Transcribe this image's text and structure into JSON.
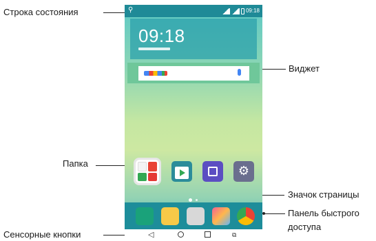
{
  "callouts": {
    "status_bar": "Строка состояния",
    "widget": "Виджет",
    "folder": "Папка",
    "page_indicator": "Значок страницы",
    "quick_access_line1": "Панель быстрого",
    "quick_access_line2": "доступа",
    "touch_buttons": "Сенсорные кнопки"
  },
  "phone": {
    "status_bar": {
      "time": "09:18",
      "usb_icon": "usb-icon"
    },
    "clock_widget": {
      "time": "09:18"
    },
    "search_widget": {
      "icons": [
        "google-logo-icon",
        "microphone-icon"
      ]
    },
    "home_apps": [
      "folder-icon",
      "play-store-icon",
      "gallery-icon",
      "settings-icon"
    ],
    "page_indicator": {
      "pages": 2,
      "current": 1
    },
    "dock_apps": [
      "phone-icon",
      "messages-icon",
      "camera-icon",
      "photos-icon",
      "chrome-icon"
    ],
    "nav_buttons": [
      "back-icon",
      "home-icon",
      "recent-apps-icon",
      "dual-window-icon"
    ]
  },
  "colors": {
    "status_bar": "#1f8a97",
    "dock": "#1d8d9a",
    "accent": "#5ec9c6"
  }
}
